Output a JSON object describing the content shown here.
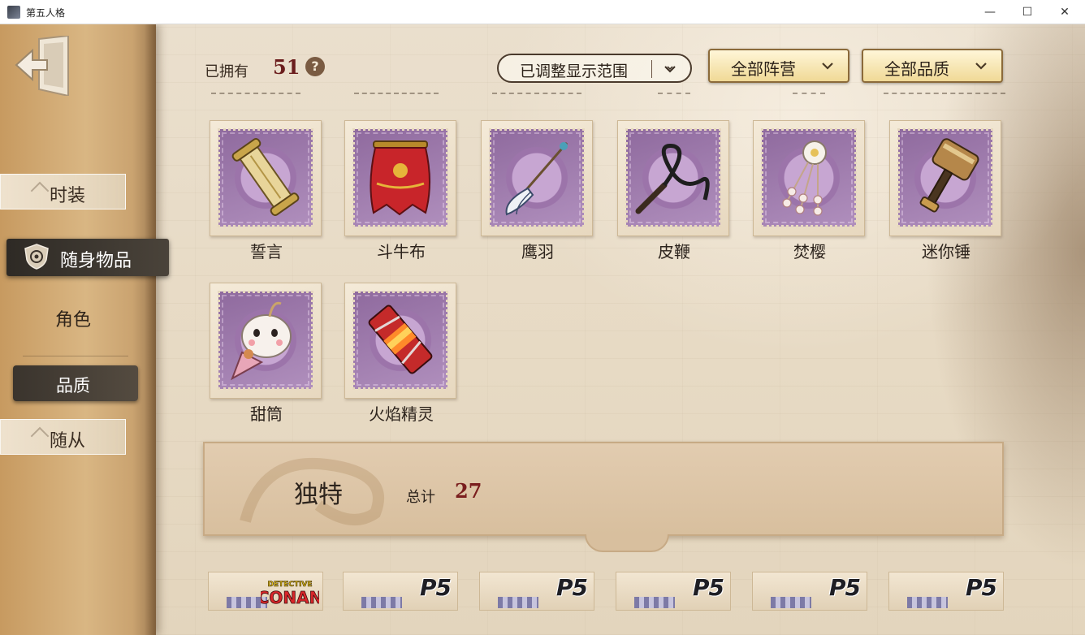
{
  "window": {
    "title": "第五人格",
    "minimize_glyph": "—",
    "maximize_glyph": "☐",
    "close_glyph": "✕"
  },
  "sidebar": {
    "skin_label": "时装",
    "accessory_label": "随身物品",
    "follower_label": "随从",
    "filter_role_label": "角色",
    "filter_quality_label": "品质"
  },
  "header": {
    "owned_label": "已拥有",
    "owned_count": "51",
    "help_glyph": "?",
    "range_select": "已调整显示范围",
    "camp_select": "全部阵营",
    "quality_select": "全部品质"
  },
  "items": [
    {
      "name": "誓言",
      "icon": "scroll-icon"
    },
    {
      "name": "斗牛布",
      "icon": "red-cape-icon"
    },
    {
      "name": "鹰羽",
      "icon": "feather-icon"
    },
    {
      "name": "皮鞭",
      "icon": "whip-icon"
    },
    {
      "name": "焚樱",
      "icon": "blossom-icon"
    },
    {
      "name": "迷你锤",
      "icon": "mini-hammer-icon"
    },
    {
      "name": "甜筒",
      "icon": "ice-cream-icon"
    },
    {
      "name": "火焰精灵",
      "icon": "flame-spirit-icon"
    }
  ],
  "section": {
    "title": "独特",
    "total_label": "总计",
    "total_count": "27"
  },
  "bottom_row": [
    {
      "logo": "CONAN",
      "logo_top": "DETECTIVE"
    },
    {
      "logo": "P5"
    },
    {
      "logo": "P5"
    },
    {
      "logo": "P5"
    },
    {
      "logo": "P5"
    },
    {
      "logo": "P5"
    }
  ],
  "colors": {
    "stamp_purple": "#9c74aa",
    "count_red": "#6b1d1d",
    "selected_dark": "#2e2a25",
    "gold_button": "#f0d996"
  }
}
